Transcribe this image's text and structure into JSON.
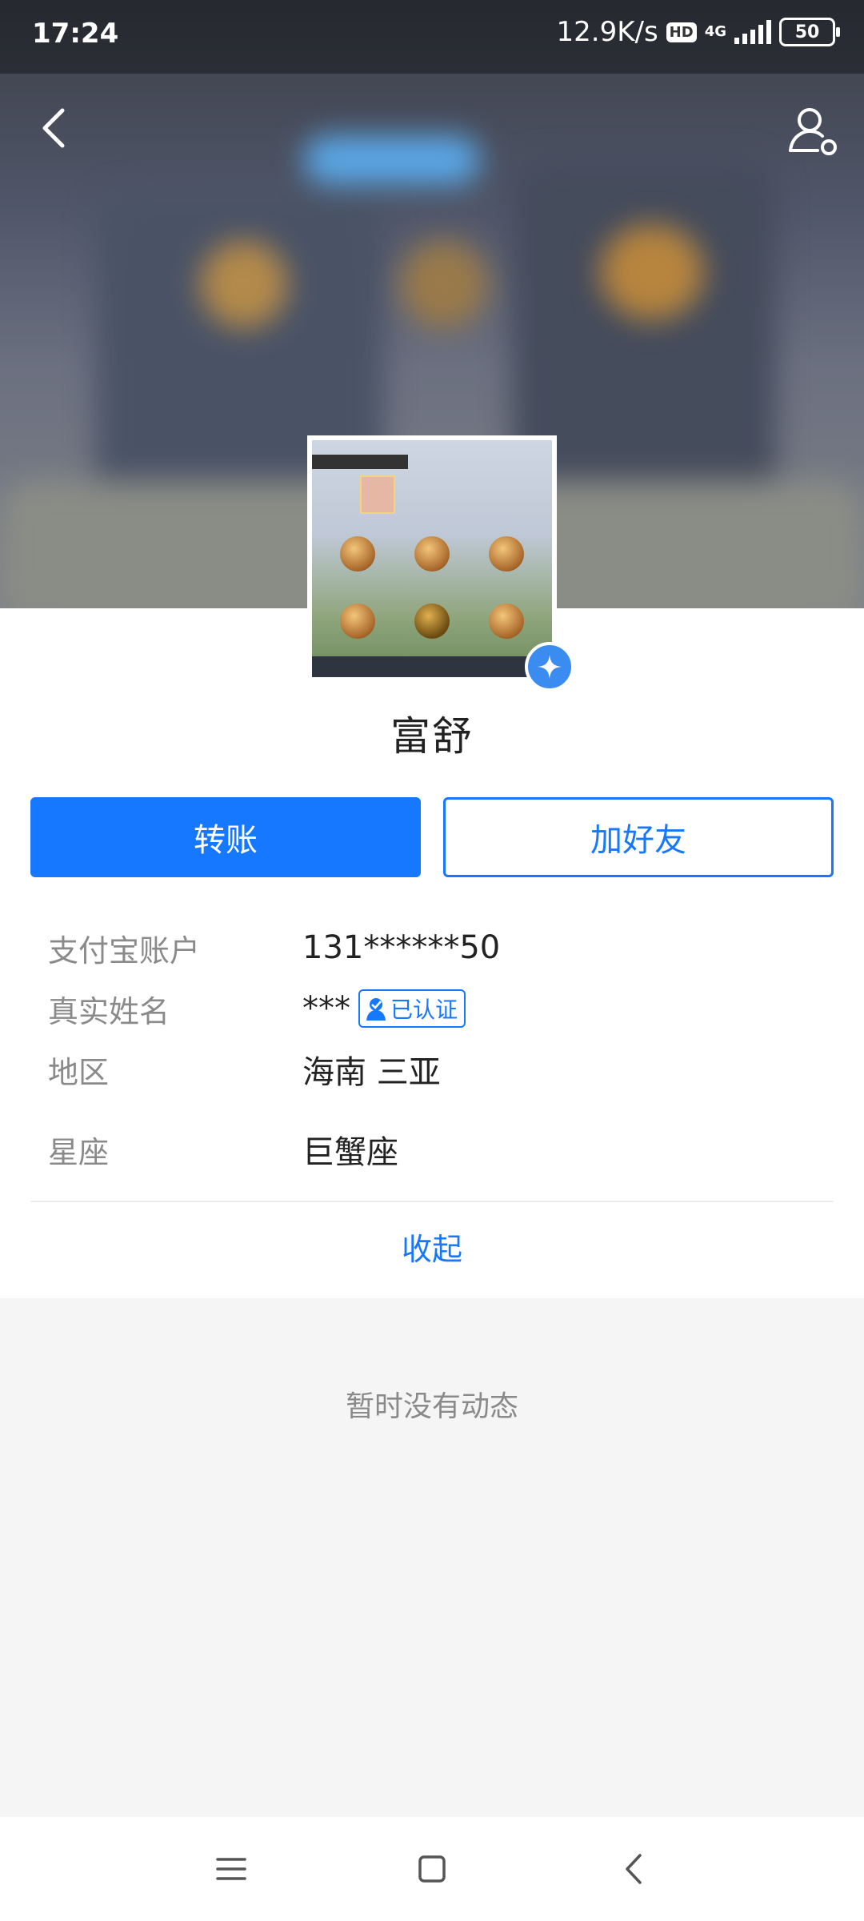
{
  "status_bar": {
    "time": "17:24",
    "speed": "12.9K/s",
    "hd": "HD",
    "network": "4G",
    "battery": "50"
  },
  "header": {
    "back_icon": "chevron-left-icon",
    "profile_icon": "user-settings-icon"
  },
  "profile": {
    "name": "富舒",
    "verified_icon": "verified-star-icon"
  },
  "actions": {
    "transfer_label": "转账",
    "add_friend_label": "加好友"
  },
  "details": {
    "account_label": "支付宝账户",
    "account_value": "131******50",
    "realname_label": "真实姓名",
    "realname_value": "***",
    "realname_badge": "已认证",
    "region_label": "地区",
    "region_value": "海南 三亚",
    "zodiac_label": "星座",
    "zodiac_value": "巨蟹座"
  },
  "collapse_label": "收起",
  "feed": {
    "empty_text": "暂时没有动态"
  },
  "colors": {
    "accent": "#1677ff",
    "muted_text": "#8a8a8a",
    "page_bg": "#f5f5f5"
  }
}
